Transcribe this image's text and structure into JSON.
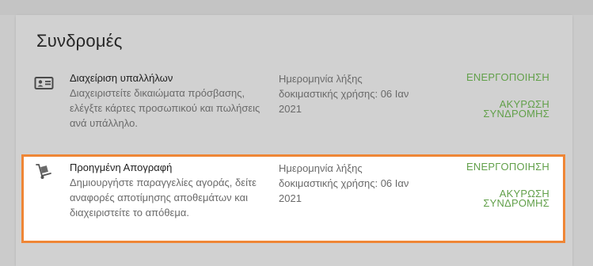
{
  "page_title": "Συνδρομές",
  "subscriptions": [
    {
      "icon": "id-card-icon",
      "name": "Διαχείριση υπαλλήλων",
      "description": "Διαχειριστείτε δικαιώματα πρόσβασης, ελέγξτε κάρτες προσωπικού και πωλήσεις ανά υπάλληλο.",
      "expiry": "Ημερομηνία λήξης δοκιμαστικής χρήσης: 06 Ιαν 2021",
      "activate_label": "ΕΝΕΡΓΟΠΟΙΗΣΗ",
      "cancel_label": "ΑΚΥΡΩΣΗ ΣΥΝΔΡΟΜΗΣ",
      "highlighted": false
    },
    {
      "icon": "hand-truck-icon",
      "name": "Προηγμένη Απογραφή",
      "description": "Δημιουργήστε παραγγελίες αγοράς, δείτε αναφορές αποτίμησης αποθεμάτων και διαχειριστείτε το απόθεμα.",
      "expiry": "Ημερομηνία λήξης δοκιμαστικής χρήσης: 06 Ιαν 2021",
      "activate_label": "ΕΝΕΡΓΟΠΟΙΗΣΗ",
      "cancel_label": "ΑΚΥΡΩΣΗ ΣΥΝΔΡΟΜΗΣ",
      "highlighted": true
    }
  ],
  "colors": {
    "accent": "#62a04a",
    "highlight_border": "#ef8636",
    "background": "#cbcbcb",
    "card": "#d1d1d1"
  }
}
